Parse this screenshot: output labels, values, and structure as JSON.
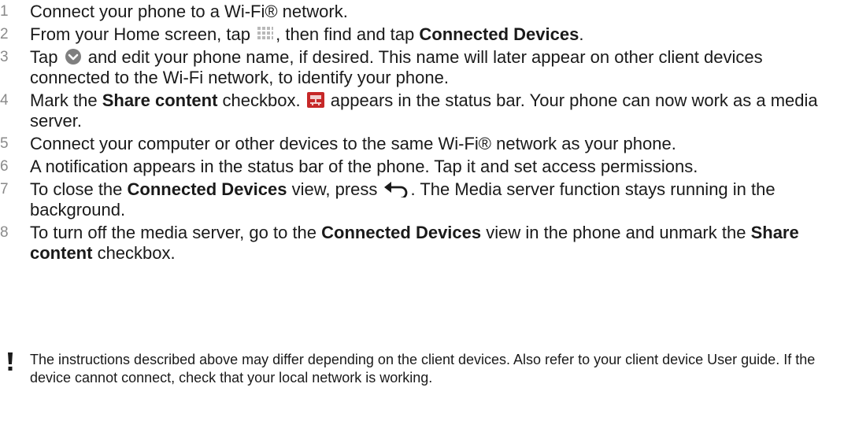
{
  "steps": [
    {
      "num": "1",
      "text": "Connect your phone to a Wi-Fi® network."
    },
    {
      "num": "2",
      "before": "From your Home screen, tap ",
      "middle": ", then find and tap ",
      "bold": "Connected Devices",
      "after": ".",
      "icon": "apps-grid-icon"
    },
    {
      "num": "3",
      "before": "Tap ",
      "after": " and edit your phone name, if desired. This name will later appear on other client devices connected to the Wi-Fi network, to identify your phone.",
      "icon": "chevron-down-circle-icon"
    },
    {
      "num": "4",
      "before": "Mark the ",
      "bold": "Share content",
      "middle": " checkbox. ",
      "after": " appears in the status bar. Your phone can now work as a media server.",
      "icon": "media-server-icon"
    },
    {
      "num": "5",
      "text": "Connect your computer or other devices to the same Wi-Fi® network as your phone."
    },
    {
      "num": "6",
      "text": "A notification appears in the status bar of the phone. Tap it and set access permissions."
    },
    {
      "num": "7",
      "before": "To close the ",
      "bold": "Connected Devices",
      "middle": " view, press ",
      "after": ". The Media server function stays running in the background.",
      "icon": "back-icon"
    },
    {
      "num": "8",
      "before": "To turn off the media server, go to the ",
      "bold": "Connected Devices",
      "middle": " view in the phone and unmark the ",
      "bold2": "Share content",
      "after": " checkbox."
    }
  ],
  "note": {
    "icon": "exclamation-icon",
    "text": "The instructions described above may differ depending on the client devices. Also refer to your client device User guide. If the device cannot connect, check that your local network is working."
  },
  "colors": {
    "text": "#1a1a1a",
    "step_number": "#8a8a8a",
    "chevron_icon": "#7f7f7f",
    "server_icon": "#c62828"
  }
}
